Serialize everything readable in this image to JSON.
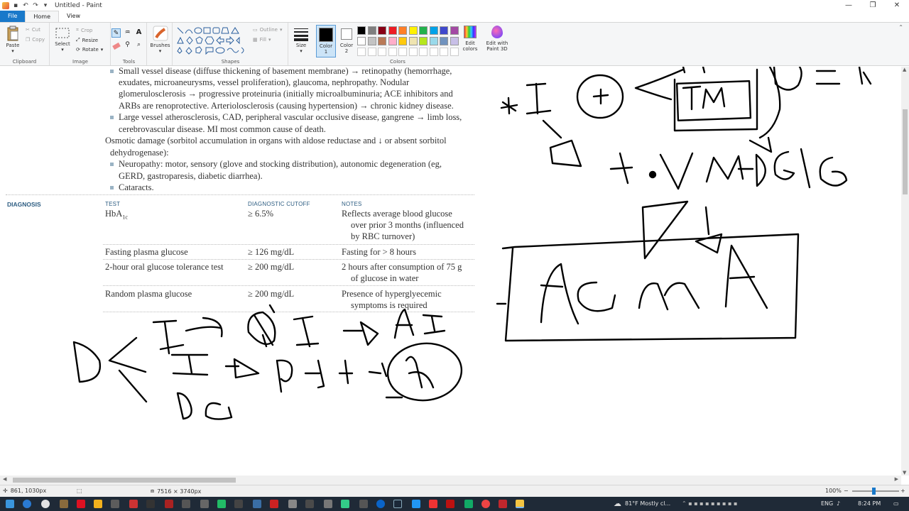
{
  "window": {
    "title": "Untitled - Paint",
    "controls": [
      "—",
      "❐",
      "✕"
    ]
  },
  "tabs": [
    {
      "label": "File"
    },
    {
      "label": "Home"
    },
    {
      "label": "View"
    }
  ],
  "ribbon": {
    "clipboard": {
      "label": "Clipboard",
      "paste": "Paste",
      "cut": "Cut",
      "copy": "Copy"
    },
    "image": {
      "label": "Image",
      "select": "Select",
      "crop": "Crop",
      "resize": "Resize",
      "rotate": "Rotate"
    },
    "tools": {
      "label": "Tools"
    },
    "brushes": {
      "label": "Brushes"
    },
    "shapes": {
      "label": "Shapes",
      "outline": "Outline",
      "fill": "Fill"
    },
    "size": {
      "label": "Size"
    },
    "color1": {
      "label": "Color\n1",
      "label_line1": "Color",
      "label_line2": "1"
    },
    "color2": {
      "label_line1": "Color",
      "label_line2": "2"
    },
    "colors": {
      "label": "Colors"
    },
    "edit_colors": {
      "line1": "Edit",
      "line2": "colors"
    },
    "paint3d": {
      "line1": "Edit with",
      "line2": "Paint 3D"
    },
    "palette_row1": [
      "#000000",
      "#7f7f7f",
      "#880015",
      "#ed1c24",
      "#ff7f27",
      "#fff200",
      "#22b14c",
      "#00a2e8",
      "#3f48cc",
      "#a349a4"
    ],
    "palette_row2": [
      "#ffffff",
      "#c3c3c3",
      "#b97a57",
      "#ffaec9",
      "#ffc90e",
      "#efe4b0",
      "#b5e61d",
      "#99d9ea",
      "#7092be",
      "#c8bfe7"
    ]
  },
  "document": {
    "lines": [
      "Small vessel disease (diffuse thickening of basement membrane) → retinopathy (hemorrhage,",
      "exudates, microaneurysms, vessel proliferation), glaucoma, nephropathy. Nodular",
      "glomerulosclerosis → progressive proteinuria (initially microalbuminuria; ACE inhibitors and",
      "ARBs are renoprotective. Arteriolosclerosis (causing hypertension) → chronic kidney disease.",
      "Large vessel atherosclerosis, CAD, peripheral vascular occlusive disease, gangrene → limb loss,",
      "cerebrovascular disease. MI most common cause of death.",
      "Osmotic damage (sorbitol accumulation in organs with aldose reductase and ↓ or absent sorbitol",
      "dehydrogenase):",
      "Neuropathy: motor, sensory (glove and stocking distribution), autonomic degeneration (eg,",
      "GERD, gastroparesis, diabetic diarrhea).",
      "Cataracts."
    ],
    "diagnosis_label": "DIAGNOSIS",
    "table_headers": [
      "TEST",
      "DIAGNOSTIC CUTOFF",
      "NOTES"
    ],
    "rows": [
      {
        "test": "HbA",
        "test_sub": "1c",
        "cutoff": "≥ 6.5%",
        "notes": [
          "Reflects average blood glucose",
          "over prior 3 months (influenced",
          "by RBC turnover)"
        ]
      },
      {
        "test": "Fasting plasma glucose",
        "cutoff": "≥ 126 mg/dL",
        "notes": [
          "Fasting for > 8 hours"
        ]
      },
      {
        "test": "2-hour oral glucose tolerance test",
        "cutoff": "≥ 200 mg/dL",
        "notes": [
          "2 hours after consumption of 75 g",
          "of glucose in water"
        ]
      },
      {
        "test": "Random plasma glucose",
        "cutoff": "≥ 200 mg/dL",
        "notes": [
          "Presence of hyperglyecemic",
          "symptoms is required"
        ]
      }
    ]
  },
  "status": {
    "cursor": "861, 1030px",
    "dimensions": "7516 × 3740px",
    "zoom": "100%"
  },
  "taskbar": {
    "weather": "81°F  Mostly cl...",
    "language": "ENG",
    "time": "8:24 PM"
  }
}
